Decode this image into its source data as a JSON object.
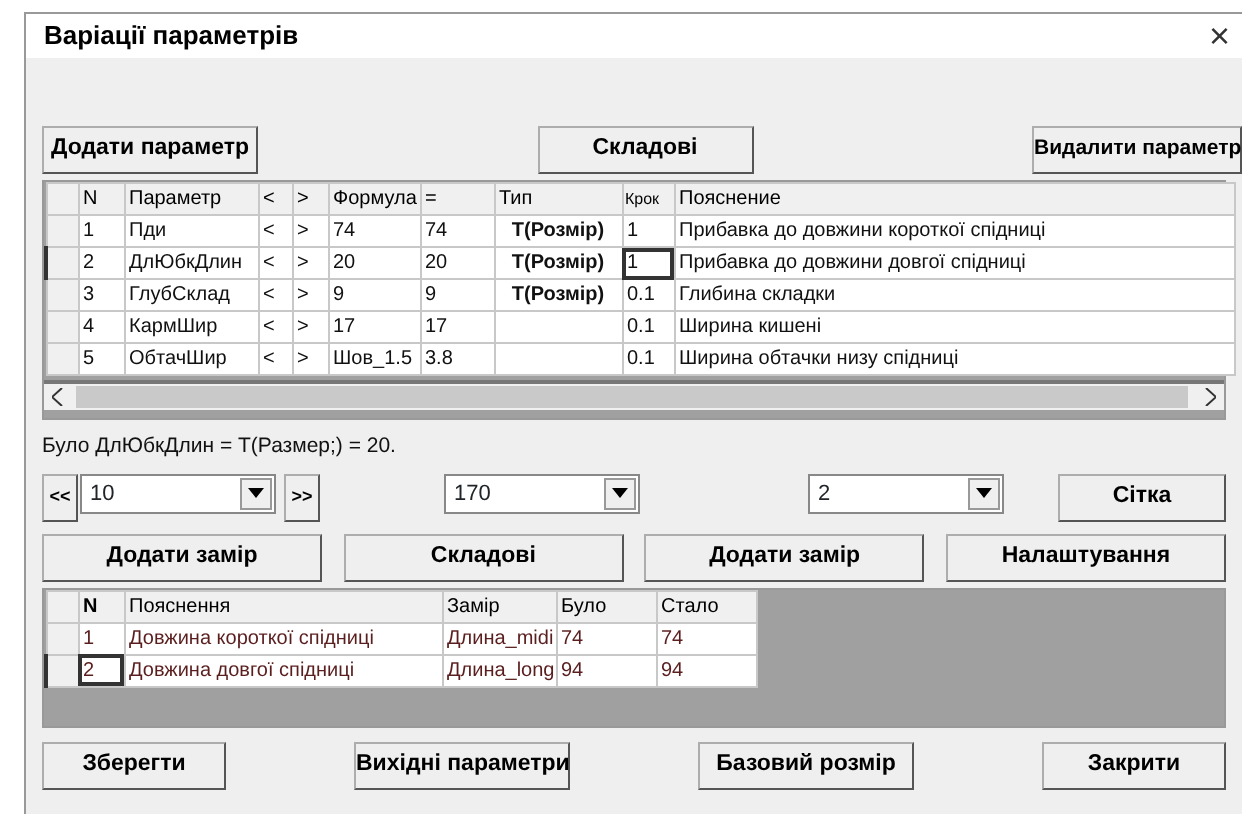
{
  "window": {
    "title": "Варіації параметрів",
    "close": "×"
  },
  "top_buttons": [
    "Додати параметр",
    "Складові",
    "Видалити параметр"
  ],
  "params_table": {
    "columns": [
      {
        "label": "N",
        "kind": "plain",
        "cursor": false
      },
      {
        "label": "Параметр",
        "kind": "plain",
        "cursor": false
      },
      {
        "label": "<",
        "kind": "plain",
        "cursor": false
      },
      {
        "label": ">",
        "kind": "plain",
        "cursor": false
      },
      {
        "label": "Формула",
        "kind": "plain",
        "cursor": false
      },
      {
        "label": "=",
        "kind": "plain",
        "cursor": false
      },
      {
        "label": "Тип",
        "kind": "bold",
        "cursor": false
      },
      {
        "label": "Крок",
        "kind": "plain",
        "cursor": true
      },
      {
        "label": "Пояснение",
        "kind": "plain",
        "cursor": false
      }
    ],
    "rows": [
      {
        "cells": [
          "1",
          "Пди",
          "<",
          ">",
          "74",
          "74",
          "T(Розмір)",
          "1",
          "Прибавка до довжини короткої спідниці"
        ],
        "selected": false
      },
      {
        "cells": [
          "2",
          "ДлЮбкДлин",
          "<",
          ">",
          "20",
          "20",
          "T(Розмір)",
          "1",
          "Прибавка до довжини довгої спідниці"
        ],
        "selected": true
      },
      {
        "cells": [
          "3",
          "ГлубСклад",
          "<",
          ">",
          "9",
          "9",
          "T(Розмір)",
          "0.1",
          "Глибина складки"
        ],
        "selected": false
      },
      {
        "cells": [
          "4",
          "КармШир",
          "<",
          ">",
          "17",
          "17",
          "",
          "0.1",
          "Ширина кишені"
        ],
        "selected": false
      },
      {
        "cells": [
          "5",
          "ОбтачШир",
          "<",
          ">",
          "Шов_1.5",
          "3.8",
          "",
          "0.1",
          "Ширина обтачки низу спідниці"
        ],
        "selected": false
      }
    ]
  },
  "note": "Було ДлЮбкДлин = T(Размер;) = 20.",
  "prev_button": "<<",
  "next_button": ">>",
  "dropdowns": [
    "10",
    "170",
    "2"
  ],
  "grid_button": "Сітка",
  "middle_buttons": [
    "Додати замір",
    "Складові",
    "Додати замір",
    "Налаштування"
  ],
  "measures_table": {
    "columns": [
      {
        "label": "N",
        "cursor": true
      },
      {
        "label": "Пояснення",
        "cursor": false
      },
      {
        "label": "Замір",
        "cursor": false
      },
      {
        "label": "Було",
        "cursor": false
      },
      {
        "label": "Стало",
        "cursor": false
      }
    ],
    "rows": [
      {
        "cells": [
          "1",
          "Довжина короткої спідниці",
          "Длина_midi",
          "74",
          "74"
        ],
        "selected": false
      },
      {
        "cells": [
          "2",
          "Довжина довгої спідниці",
          "Длина_long",
          "94",
          "94"
        ],
        "selected": true
      }
    ]
  },
  "bottom_buttons": [
    "Зберегти",
    "Вихідні параметри",
    "Базовий розмір",
    "Закрити"
  ]
}
